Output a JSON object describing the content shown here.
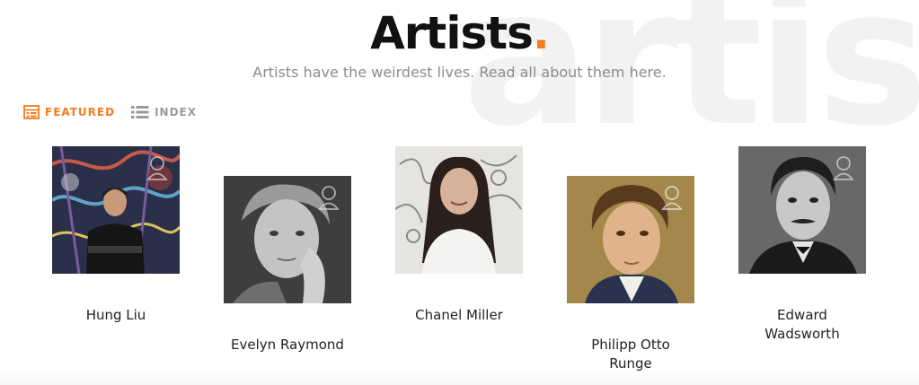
{
  "header": {
    "title": "Artists",
    "title_dot": ".",
    "subtitle": "Artists have the weirdest lives. Read all about them here.",
    "watermark": "artis"
  },
  "tabs": [
    {
      "label": "FEATURED",
      "icon": "featured-grid-icon",
      "active": true
    },
    {
      "label": "INDEX",
      "icon": "list-icon",
      "active": false
    }
  ],
  "colors": {
    "accent": "#f47b20",
    "subtitle": "#8c8c8c",
    "watermark": "#f2f2f2"
  },
  "artists": [
    {
      "name": "Hung Liu"
    },
    {
      "name": "Evelyn Raymond"
    },
    {
      "name": "Chanel Miller"
    },
    {
      "name": "Philipp Otto Runge"
    },
    {
      "name": "Edward Wadsworth"
    }
  ]
}
